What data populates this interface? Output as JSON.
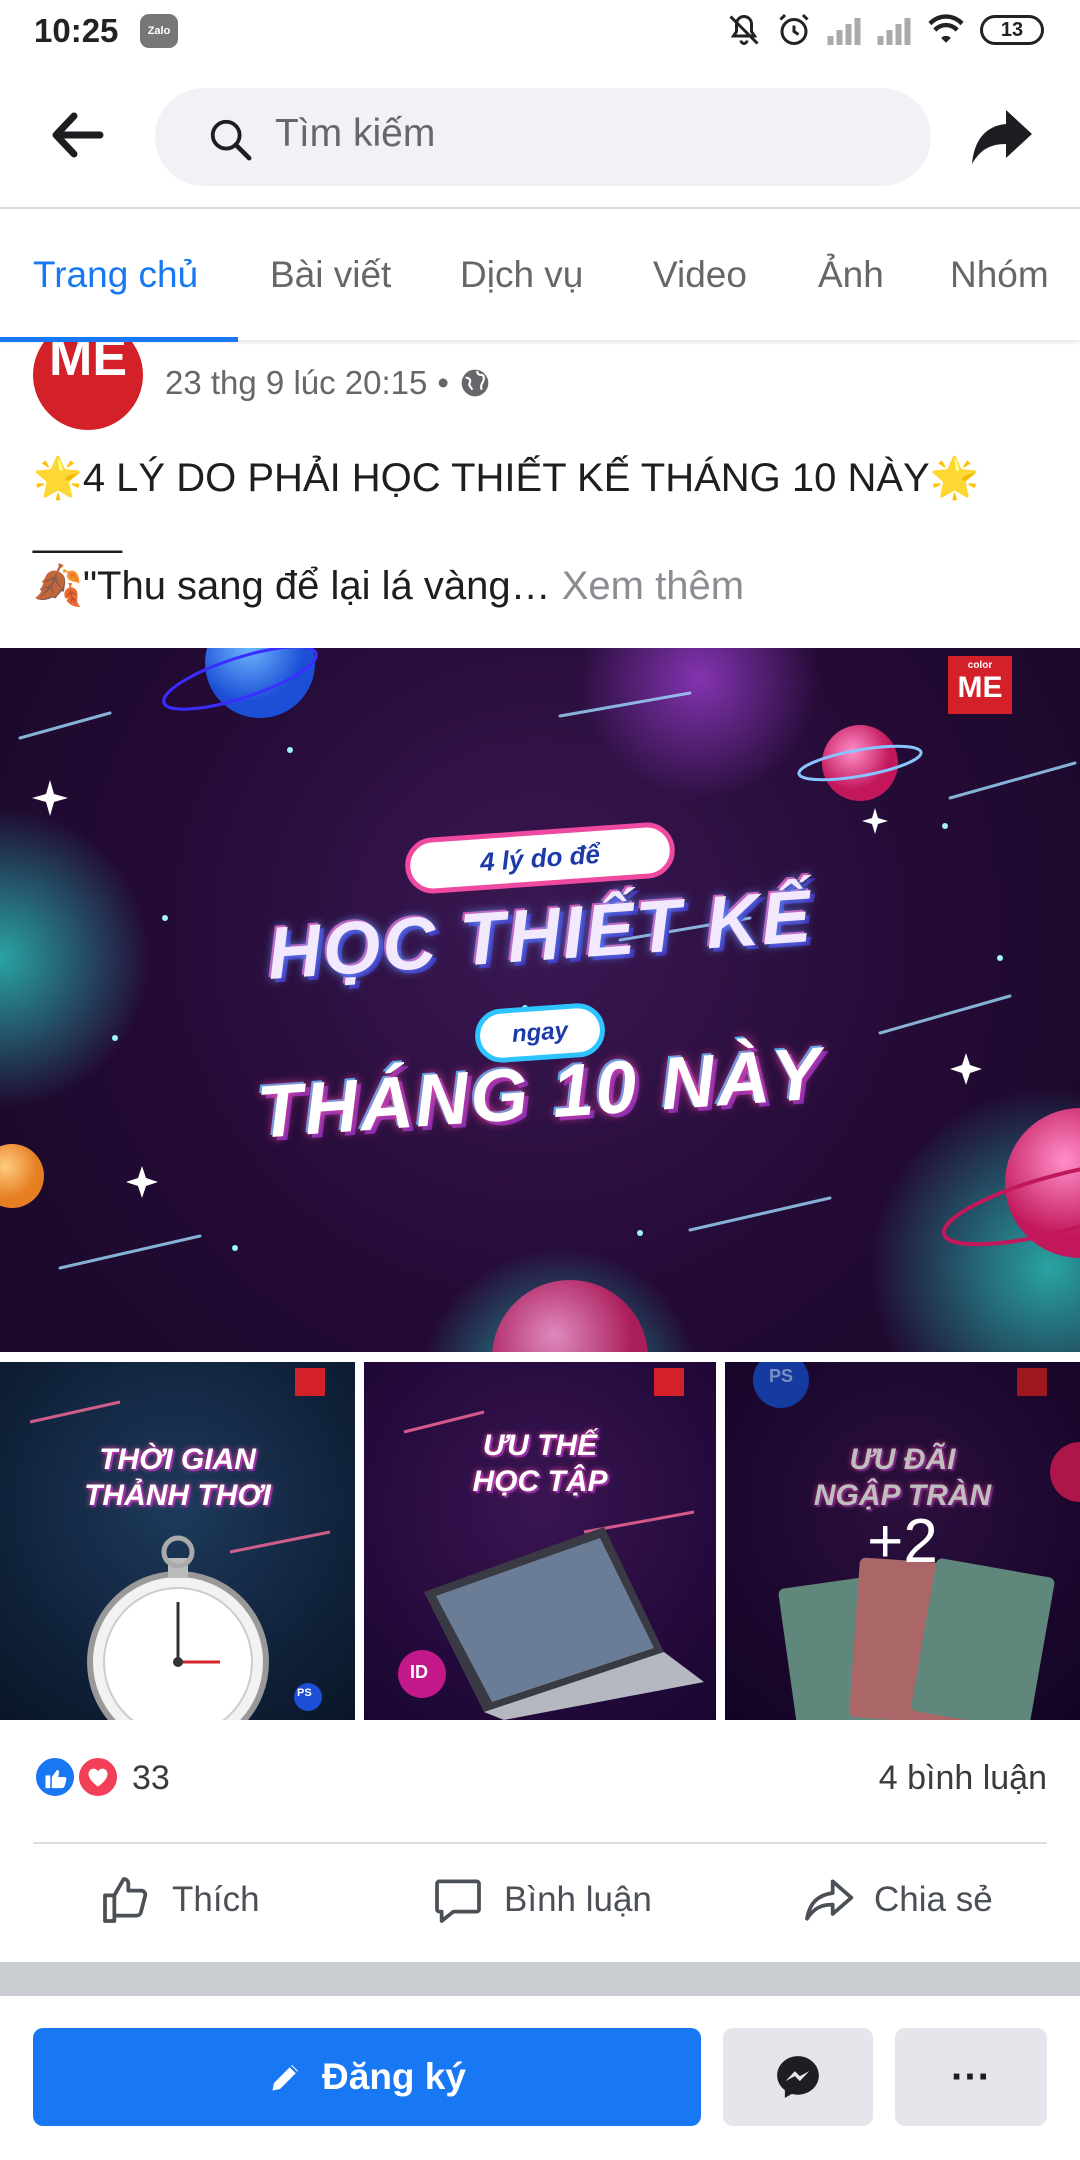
{
  "status_bar": {
    "time": "10:25",
    "zalo": "Zalo",
    "battery": "13"
  },
  "search": {
    "placeholder": "Tìm kiếm"
  },
  "tabs": [
    {
      "label": "Trang chủ",
      "active": true
    },
    {
      "label": "Bài viết"
    },
    {
      "label": "Dịch vụ"
    },
    {
      "label": "Video"
    },
    {
      "label": "Ảnh"
    },
    {
      "label": "Nhóm"
    }
  ],
  "post": {
    "avatar_text": "ME",
    "timestamp": "23 thg 9 lúc 20:15",
    "separator": "•",
    "line1": "4 LÝ DO PHẢI HỌC THIẾT KẾ THÁNG 10 NÀY",
    "line2": "____",
    "line3": "\"Thu sang để lại lá vàng…",
    "see_more": "Xem thêm",
    "emoji_star": "🌟",
    "emoji_leaf": "🍂"
  },
  "main_image": {
    "logo_small": "color",
    "logo": "ME",
    "pill1": "4 lý do để",
    "headline1": "HỌC THIẾT KẾ",
    "pill2": "ngay",
    "headline2": "THÁNG 10 NÀY"
  },
  "thumbnails": [
    {
      "title_line1": "THỜI GIAN",
      "title_line2": "THẢNH THƠI",
      "badge": "PS"
    },
    {
      "title_line1": "ƯU THẾ",
      "title_line2": "HỌC TẬP",
      "badge": "ID"
    },
    {
      "title_line1": "ƯU ĐÃI",
      "title_line2": "NGẬP TRÀN",
      "badge": "PS",
      "more": "+2"
    }
  ],
  "reactions": {
    "count": "33",
    "comments": "4 bình luận"
  },
  "actions": {
    "like": "Thích",
    "comment": "Bình luận",
    "share": "Chia sẻ"
  },
  "bottom": {
    "signup": "Đăng ký",
    "more": "···"
  },
  "colors": {
    "accent": "#1877f2",
    "like": "#1877f2",
    "love": "#f33e58",
    "brand_red": "#d32029"
  }
}
